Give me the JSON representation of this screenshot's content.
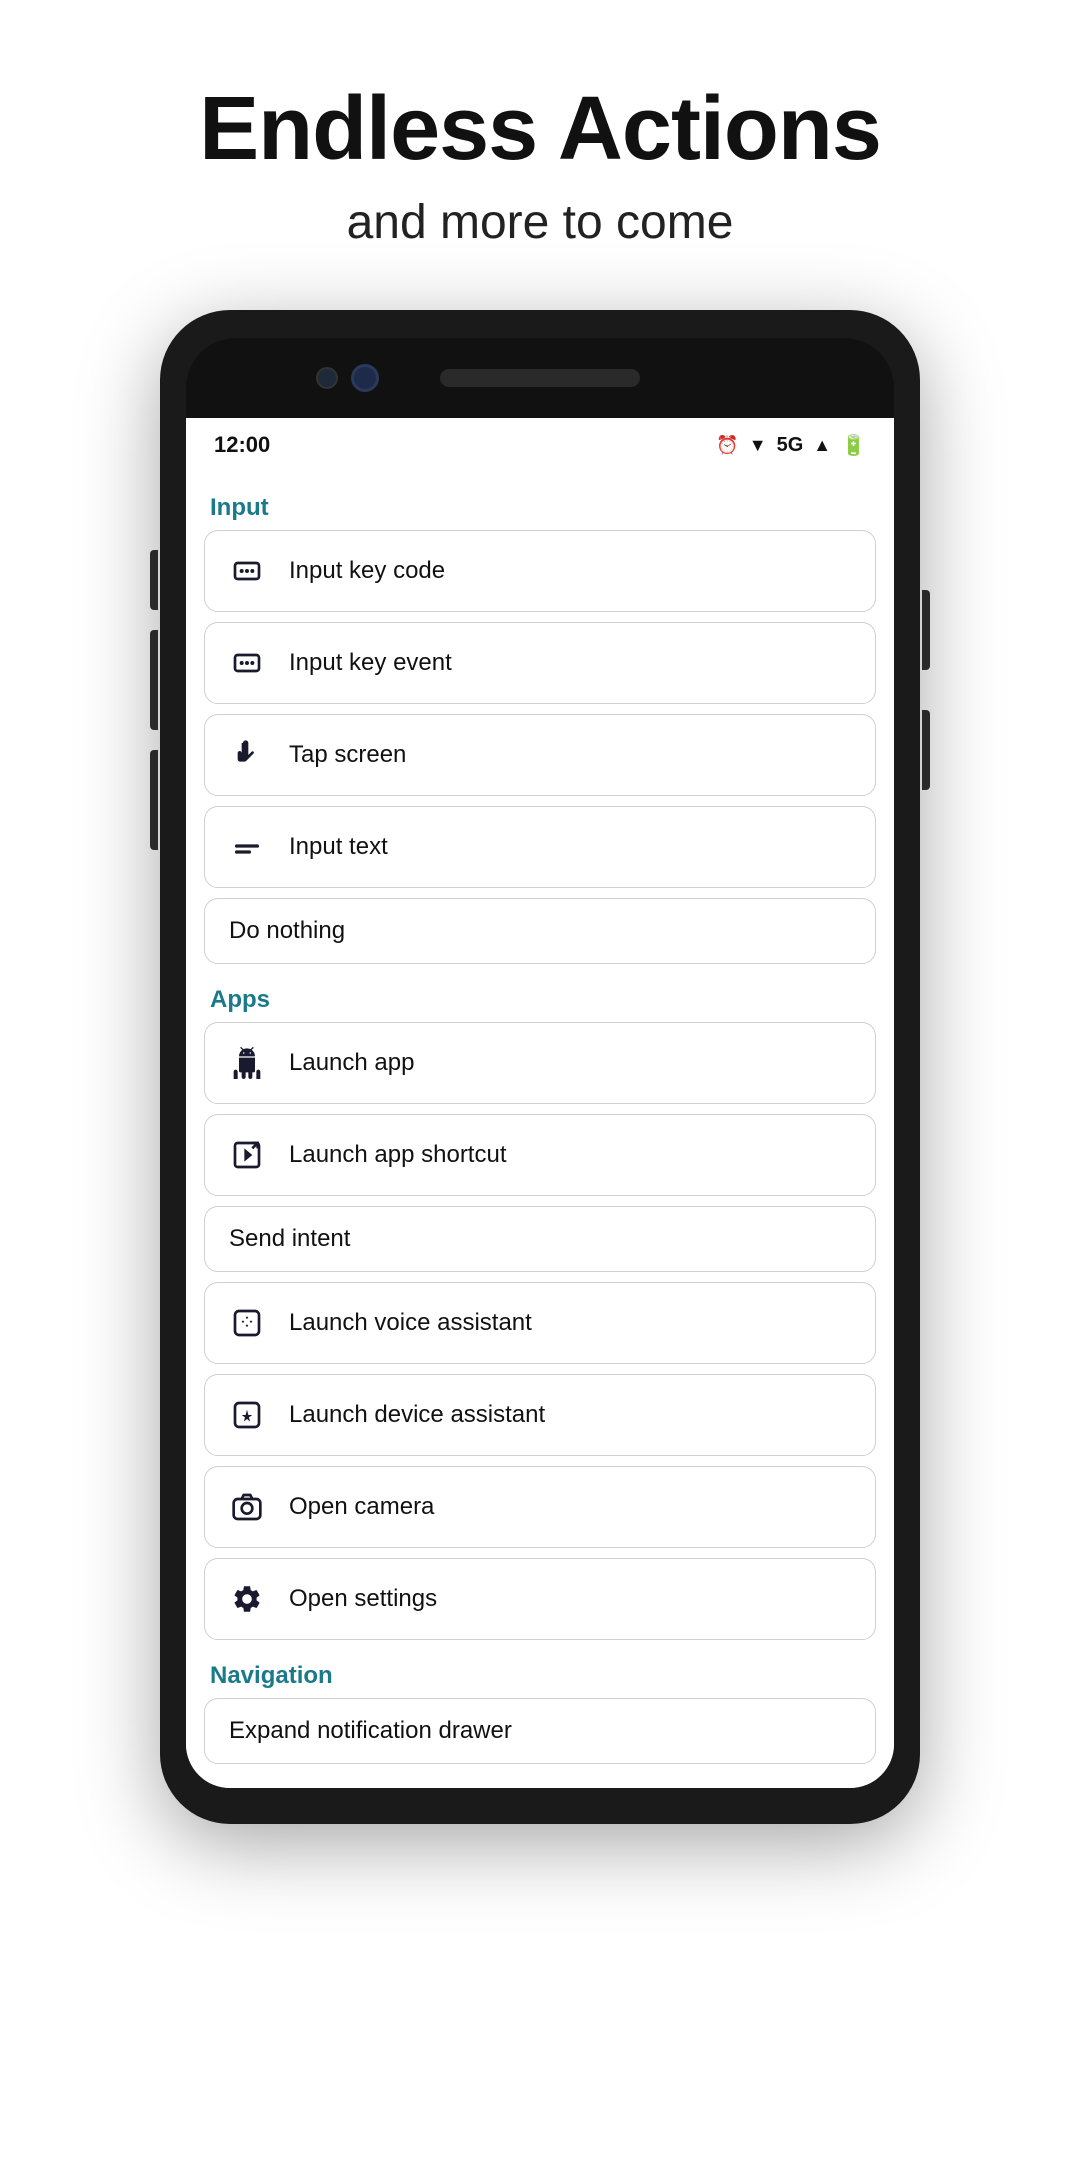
{
  "header": {
    "title": "Endless Actions",
    "subtitle": "and more to come"
  },
  "statusBar": {
    "time": "12:00",
    "network": "5G",
    "alarmIcon": "🔔"
  },
  "sections": [
    {
      "id": "input",
      "label": "Input",
      "items": [
        {
          "id": "input-key-code",
          "label": "Input key code",
          "hasIcon": true,
          "iconType": "keycode"
        },
        {
          "id": "input-key-event",
          "label": "Input key event",
          "hasIcon": true,
          "iconType": "keyevent"
        },
        {
          "id": "tap-screen",
          "label": "Tap screen",
          "hasIcon": true,
          "iconType": "tap"
        },
        {
          "id": "input-text",
          "label": "Input text",
          "hasIcon": true,
          "iconType": "text"
        },
        {
          "id": "do-nothing",
          "label": "Do nothing",
          "hasIcon": false
        }
      ]
    },
    {
      "id": "apps",
      "label": "Apps",
      "items": [
        {
          "id": "launch-app",
          "label": "Launch app",
          "hasIcon": true,
          "iconType": "android"
        },
        {
          "id": "launch-app-shortcut",
          "label": "Launch app shortcut",
          "hasIcon": true,
          "iconType": "shortcut"
        },
        {
          "id": "send-intent",
          "label": "Send intent",
          "hasIcon": false
        },
        {
          "id": "launch-voice-assistant",
          "label": "Launch voice assistant",
          "hasIcon": true,
          "iconType": "voice"
        },
        {
          "id": "launch-device-assistant",
          "label": "Launch device assistant",
          "hasIcon": true,
          "iconType": "device"
        },
        {
          "id": "open-camera",
          "label": "Open camera",
          "hasIcon": true,
          "iconType": "camera"
        },
        {
          "id": "open-settings",
          "label": "Open settings",
          "hasIcon": true,
          "iconType": "settings"
        }
      ]
    },
    {
      "id": "navigation",
      "label": "Navigation",
      "items": [
        {
          "id": "expand-notification",
          "label": "Expand notification drawer",
          "hasIcon": false
        }
      ]
    }
  ]
}
